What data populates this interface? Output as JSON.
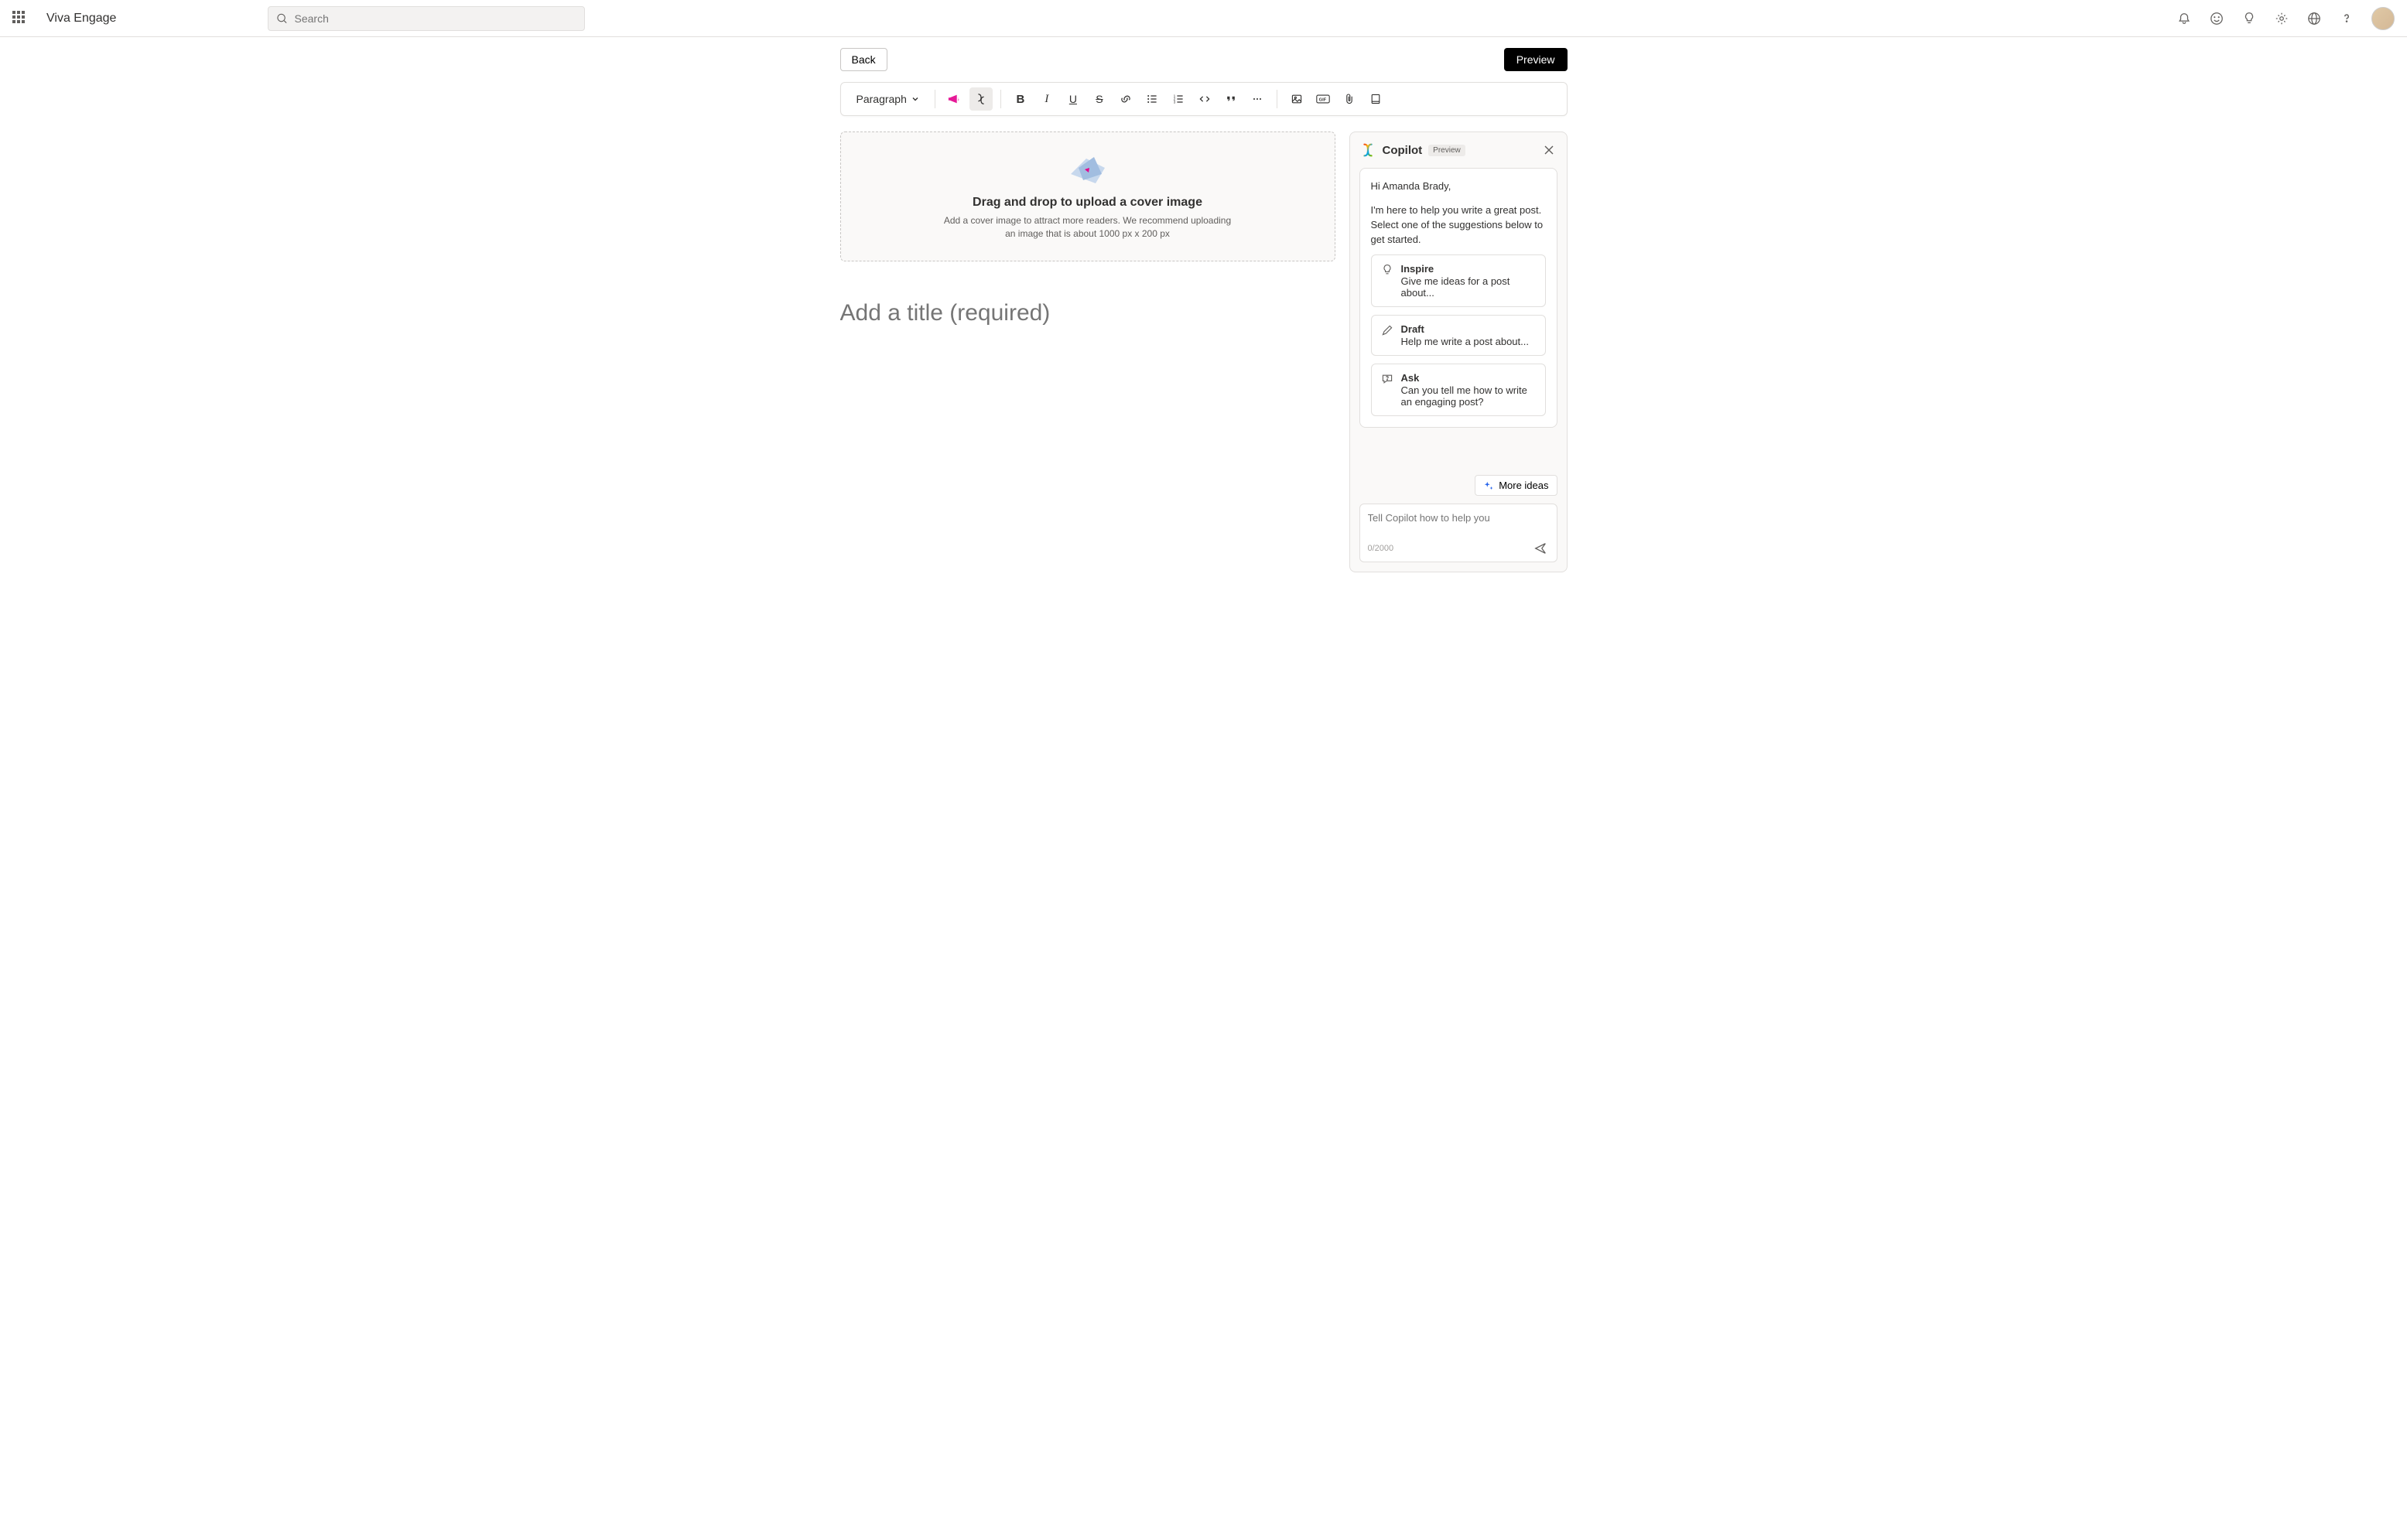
{
  "header": {
    "brand": "Viva Engage",
    "search_placeholder": "Search"
  },
  "subbar": {
    "back_label": "Back",
    "preview_label": "Preview"
  },
  "toolbar": {
    "style_dropdown_label": "Paragraph"
  },
  "dropzone": {
    "heading": "Drag and drop to upload a cover image",
    "subtext": "Add a cover image to attract more readers. We recommend uploading an image that is about 1000 px x 200 px"
  },
  "editor": {
    "title_placeholder": "Add a title (required)"
  },
  "copilot": {
    "title": "Copilot",
    "badge": "Preview",
    "greeting": "Hi Amanda Brady,",
    "intro": "I'm here to help you write a great post. Select one of the suggestions below to get started.",
    "suggestions": [
      {
        "label": "Inspire",
        "sub": "Give me ideas for a post about..."
      },
      {
        "label": "Draft",
        "sub": "Help me write a post about..."
      },
      {
        "label": "Ask",
        "sub": "Can you tell me how to write an engaging post?"
      }
    ],
    "more_ideas_label": "More ideas",
    "input_placeholder": "Tell Copilot how to help you",
    "char_count": "0/2000"
  }
}
